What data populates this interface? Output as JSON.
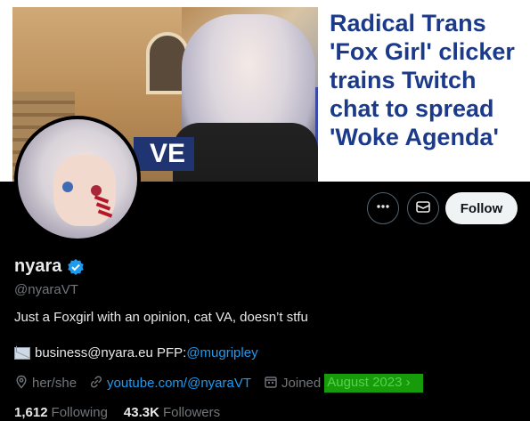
{
  "banner": {
    "headline": "Radical Trans 'Fox Girl' clicker trains Twitch chat to spread 'Woke Agenda'",
    "live_tag": "VE"
  },
  "actions": {
    "more_icon": "more-horizontal-icon",
    "message_icon": "mail-icon",
    "follow_label": "Follow"
  },
  "profile": {
    "display_name": "nyara",
    "handle": "@nyaraVT",
    "bio": "Just a Foxgirl with an opinion, cat VA, doesn’t stfu",
    "contact_text": "business@nyara.eu PFP: ",
    "contact_link": "@mugripley",
    "pronouns": "her/she",
    "website": "youtube.com/@nyaraVT",
    "joined_label": "Joined",
    "joined_date": "August 2023",
    "following_count": "1,612",
    "following_label": "Following",
    "followers_count": "43.3K",
    "followers_label": "Followers"
  },
  "colors": {
    "accent": "#1d9bf0",
    "background": "#000000",
    "muted": "#71767b"
  }
}
